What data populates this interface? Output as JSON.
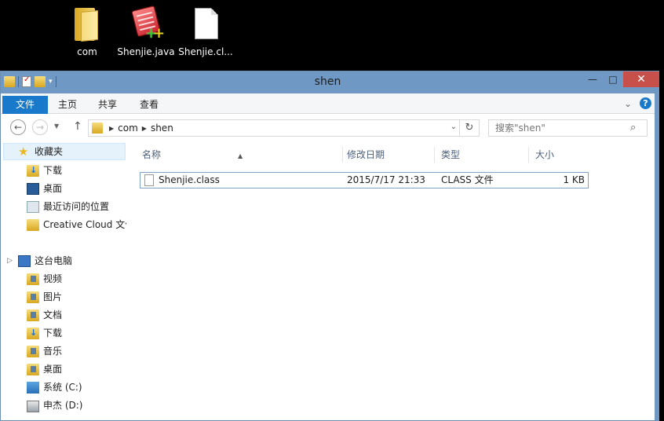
{
  "desktop": {
    "icons": [
      {
        "label": "com",
        "icon": "folder-icon"
      },
      {
        "label": "Shenjie.java",
        "icon": "java-file-icon"
      },
      {
        "label": "Shenjie.cl...",
        "icon": "blank-file-icon"
      }
    ]
  },
  "window": {
    "title": "shen",
    "buttons": {
      "minimize": "—",
      "maximize": "□",
      "close": "✕"
    }
  },
  "ribbon": {
    "tabs": [
      "文件",
      "主页",
      "共享",
      "查看"
    ]
  },
  "nav": {
    "back": "←",
    "forward": "→",
    "up": "↑",
    "breadcrumb": [
      "com",
      "shen"
    ],
    "search_placeholder": "搜索\"shen\""
  },
  "sidebar": {
    "favorites_label": "收藏夹",
    "favorites": [
      "下载",
      "桌面",
      "最近访问的位置",
      "Creative Cloud 文件"
    ],
    "pc_label": "这台电脑",
    "pc_items": [
      "视频",
      "图片",
      "文档",
      "下载",
      "音乐",
      "桌面",
      "系统 (C:)",
      "申杰 (D:)"
    ]
  },
  "columns": {
    "name": "名称",
    "date": "修改日期",
    "type": "类型",
    "size": "大小"
  },
  "files": [
    {
      "name": "Shenjie.class",
      "date": "2015/7/17 21:33",
      "type": "CLASS 文件",
      "size": "1 KB"
    }
  ],
  "colors": {
    "accent": "#1979ca",
    "titlebar": "#6f98c4",
    "close": "#c7504a",
    "selection": "#e5f1fb"
  }
}
